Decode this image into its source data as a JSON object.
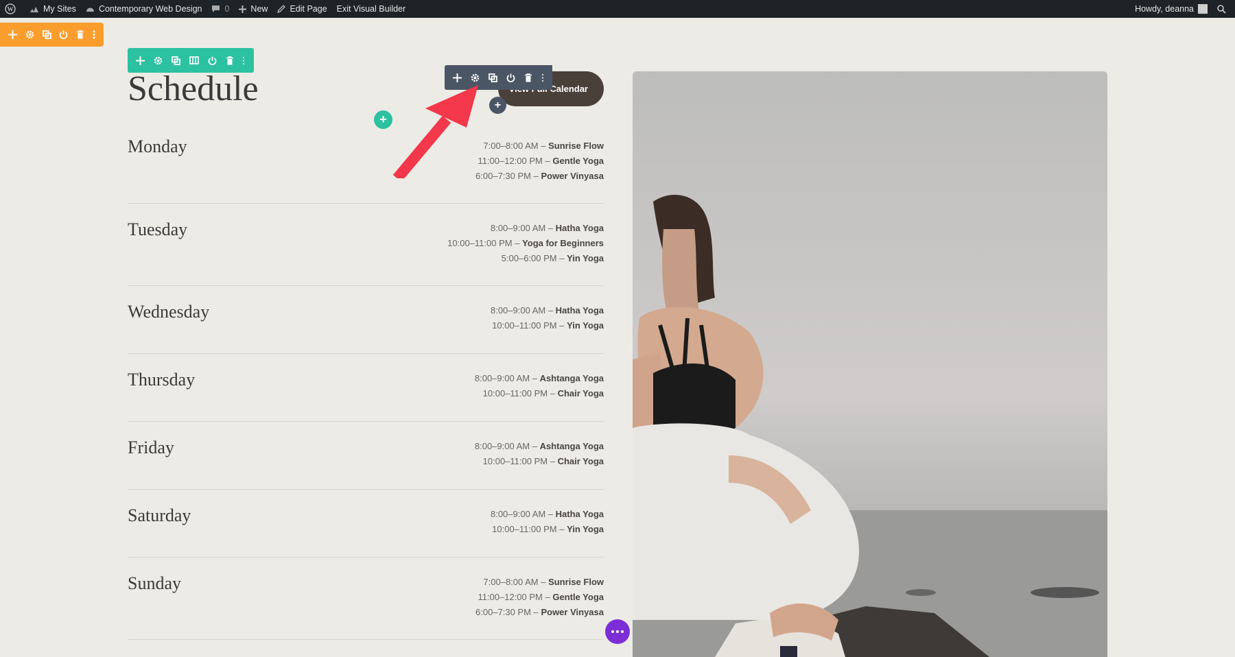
{
  "adminbar": {
    "my_sites": "My Sites",
    "site_name": "Contemporary Web Design",
    "comments_count": "0",
    "new": "New",
    "edit_page": "Edit Page",
    "exit_builder": "Exit Visual Builder",
    "howdy": "Howdy, deanna"
  },
  "page": {
    "title": "Schedule",
    "calendar_button": "View Full Calendar"
  },
  "schedule": [
    {
      "day": "Monday",
      "sessions": [
        {
          "time": "7:00–8:00 AM – ",
          "class": "Sunrise Flow"
        },
        {
          "time": "11:00–12:00 PM – ",
          "class": "Gentle Yoga"
        },
        {
          "time": "6:00–7:30 PM – ",
          "class": "Power Vinyasa"
        }
      ]
    },
    {
      "day": "Tuesday",
      "sessions": [
        {
          "time": "8:00–9:00 AM – ",
          "class": "Hatha Yoga"
        },
        {
          "time": "10:00–11:00 PM – ",
          "class": "Yoga for Beginners"
        },
        {
          "time": "5:00–6:00 PM – ",
          "class": "Yin Yoga"
        }
      ]
    },
    {
      "day": "Wednesday",
      "sessions": [
        {
          "time": "8:00–9:00 AM – ",
          "class": "Hatha Yoga"
        },
        {
          "time": "10:00–11:00 PM – ",
          "class": "Yin Yoga"
        }
      ]
    },
    {
      "day": "Thursday",
      "sessions": [
        {
          "time": "8:00–9:00 AM – ",
          "class": "Ashtanga Yoga"
        },
        {
          "time": "10:00–11:00 PM – ",
          "class": "Chair Yoga"
        }
      ]
    },
    {
      "day": "Friday",
      "sessions": [
        {
          "time": "8:00–9:00 AM – ",
          "class": "Ashtanga Yoga"
        },
        {
          "time": "10:00–11:00 PM – ",
          "class": "Chair Yoga"
        }
      ]
    },
    {
      "day": "Saturday",
      "sessions": [
        {
          "time": "8:00–9:00 AM – ",
          "class": "Hatha Yoga"
        },
        {
          "time": "10:00–11:00 PM – ",
          "class": "Yin Yoga"
        }
      ]
    },
    {
      "day": "Sunday",
      "sessions": [
        {
          "time": "7:00–8:00 AM – ",
          "class": "Sunrise Flow"
        },
        {
          "time": "11:00–12:00 PM – ",
          "class": "Gentle Yoga"
        },
        {
          "time": "6:00–7:30 PM – ",
          "class": "Power Vinyasa"
        }
      ]
    }
  ],
  "toolbars": {
    "section": [
      "move-icon",
      "gear-icon",
      "duplicate-icon",
      "power-icon",
      "trash-icon",
      "more-icon"
    ],
    "row": [
      "move-icon",
      "gear-icon",
      "duplicate-icon",
      "columns-icon",
      "power-icon",
      "trash-icon",
      "more-icon"
    ],
    "module": [
      "move-icon",
      "gear-icon",
      "duplicate-icon",
      "power-icon",
      "trash-icon",
      "more-icon"
    ]
  },
  "colors": {
    "section_toolbar": "#f99e2d",
    "row_toolbar": "#2cc1a0",
    "module_toolbar": "#4b5665",
    "annotation_arrow": "#f2384a",
    "page_settings": "#7c2ed6"
  }
}
